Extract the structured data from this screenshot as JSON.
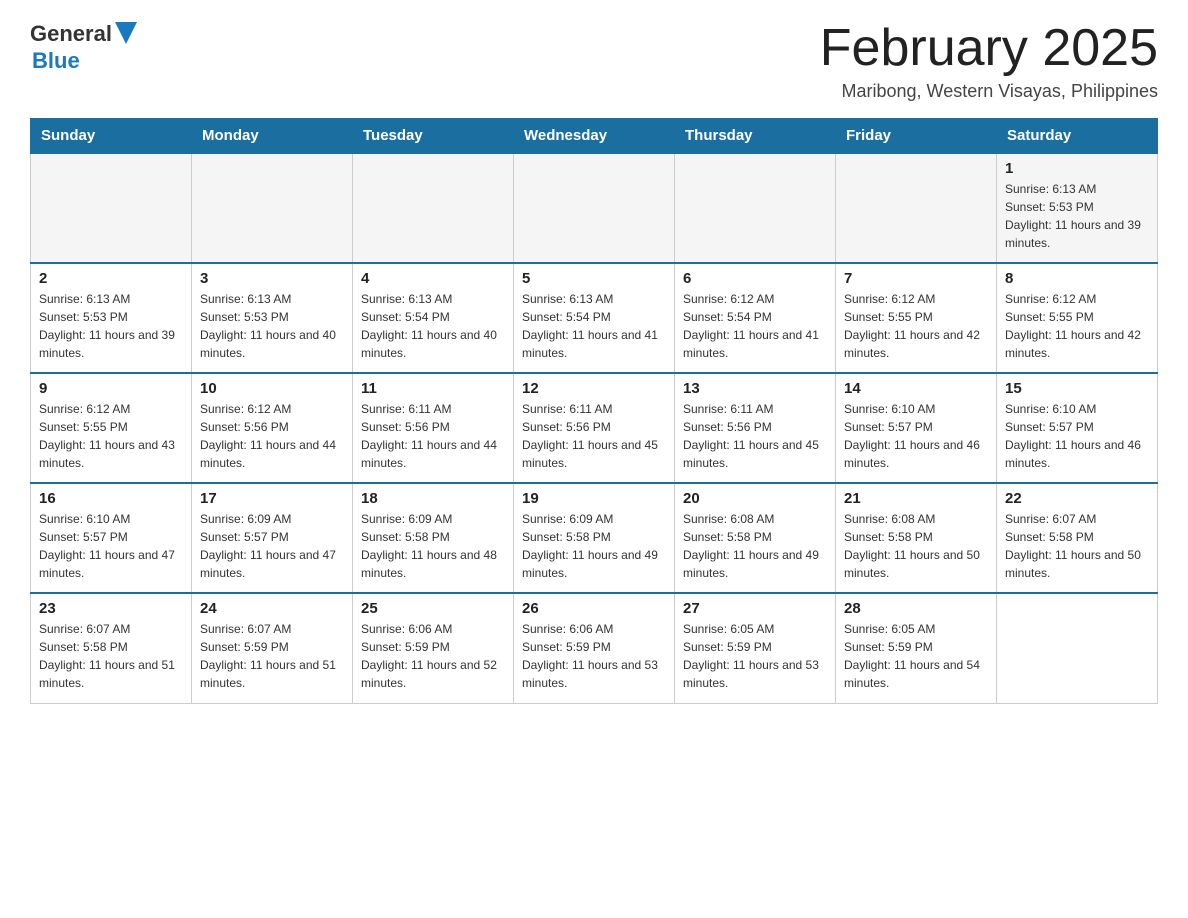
{
  "logo": {
    "general": "General",
    "blue": "Blue"
  },
  "header": {
    "month": "February 2025",
    "location": "Maribong, Western Visayas, Philippines"
  },
  "weekdays": [
    "Sunday",
    "Monday",
    "Tuesday",
    "Wednesday",
    "Thursday",
    "Friday",
    "Saturday"
  ],
  "weeks": [
    [
      {
        "day": "",
        "info": ""
      },
      {
        "day": "",
        "info": ""
      },
      {
        "day": "",
        "info": ""
      },
      {
        "day": "",
        "info": ""
      },
      {
        "day": "",
        "info": ""
      },
      {
        "day": "",
        "info": ""
      },
      {
        "day": "1",
        "info": "Sunrise: 6:13 AM\nSunset: 5:53 PM\nDaylight: 11 hours and 39 minutes."
      }
    ],
    [
      {
        "day": "2",
        "info": "Sunrise: 6:13 AM\nSunset: 5:53 PM\nDaylight: 11 hours and 39 minutes."
      },
      {
        "day": "3",
        "info": "Sunrise: 6:13 AM\nSunset: 5:53 PM\nDaylight: 11 hours and 40 minutes."
      },
      {
        "day": "4",
        "info": "Sunrise: 6:13 AM\nSunset: 5:54 PM\nDaylight: 11 hours and 40 minutes."
      },
      {
        "day": "5",
        "info": "Sunrise: 6:13 AM\nSunset: 5:54 PM\nDaylight: 11 hours and 41 minutes."
      },
      {
        "day": "6",
        "info": "Sunrise: 6:12 AM\nSunset: 5:54 PM\nDaylight: 11 hours and 41 minutes."
      },
      {
        "day": "7",
        "info": "Sunrise: 6:12 AM\nSunset: 5:55 PM\nDaylight: 11 hours and 42 minutes."
      },
      {
        "day": "8",
        "info": "Sunrise: 6:12 AM\nSunset: 5:55 PM\nDaylight: 11 hours and 42 minutes."
      }
    ],
    [
      {
        "day": "9",
        "info": "Sunrise: 6:12 AM\nSunset: 5:55 PM\nDaylight: 11 hours and 43 minutes."
      },
      {
        "day": "10",
        "info": "Sunrise: 6:12 AM\nSunset: 5:56 PM\nDaylight: 11 hours and 44 minutes."
      },
      {
        "day": "11",
        "info": "Sunrise: 6:11 AM\nSunset: 5:56 PM\nDaylight: 11 hours and 44 minutes."
      },
      {
        "day": "12",
        "info": "Sunrise: 6:11 AM\nSunset: 5:56 PM\nDaylight: 11 hours and 45 minutes."
      },
      {
        "day": "13",
        "info": "Sunrise: 6:11 AM\nSunset: 5:56 PM\nDaylight: 11 hours and 45 minutes."
      },
      {
        "day": "14",
        "info": "Sunrise: 6:10 AM\nSunset: 5:57 PM\nDaylight: 11 hours and 46 minutes."
      },
      {
        "day": "15",
        "info": "Sunrise: 6:10 AM\nSunset: 5:57 PM\nDaylight: 11 hours and 46 minutes."
      }
    ],
    [
      {
        "day": "16",
        "info": "Sunrise: 6:10 AM\nSunset: 5:57 PM\nDaylight: 11 hours and 47 minutes."
      },
      {
        "day": "17",
        "info": "Sunrise: 6:09 AM\nSunset: 5:57 PM\nDaylight: 11 hours and 47 minutes."
      },
      {
        "day": "18",
        "info": "Sunrise: 6:09 AM\nSunset: 5:58 PM\nDaylight: 11 hours and 48 minutes."
      },
      {
        "day": "19",
        "info": "Sunrise: 6:09 AM\nSunset: 5:58 PM\nDaylight: 11 hours and 49 minutes."
      },
      {
        "day": "20",
        "info": "Sunrise: 6:08 AM\nSunset: 5:58 PM\nDaylight: 11 hours and 49 minutes."
      },
      {
        "day": "21",
        "info": "Sunrise: 6:08 AM\nSunset: 5:58 PM\nDaylight: 11 hours and 50 minutes."
      },
      {
        "day": "22",
        "info": "Sunrise: 6:07 AM\nSunset: 5:58 PM\nDaylight: 11 hours and 50 minutes."
      }
    ],
    [
      {
        "day": "23",
        "info": "Sunrise: 6:07 AM\nSunset: 5:58 PM\nDaylight: 11 hours and 51 minutes."
      },
      {
        "day": "24",
        "info": "Sunrise: 6:07 AM\nSunset: 5:59 PM\nDaylight: 11 hours and 51 minutes."
      },
      {
        "day": "25",
        "info": "Sunrise: 6:06 AM\nSunset: 5:59 PM\nDaylight: 11 hours and 52 minutes."
      },
      {
        "day": "26",
        "info": "Sunrise: 6:06 AM\nSunset: 5:59 PM\nDaylight: 11 hours and 53 minutes."
      },
      {
        "day": "27",
        "info": "Sunrise: 6:05 AM\nSunset: 5:59 PM\nDaylight: 11 hours and 53 minutes."
      },
      {
        "day": "28",
        "info": "Sunrise: 6:05 AM\nSunset: 5:59 PM\nDaylight: 11 hours and 54 minutes."
      },
      {
        "day": "",
        "info": ""
      }
    ]
  ]
}
